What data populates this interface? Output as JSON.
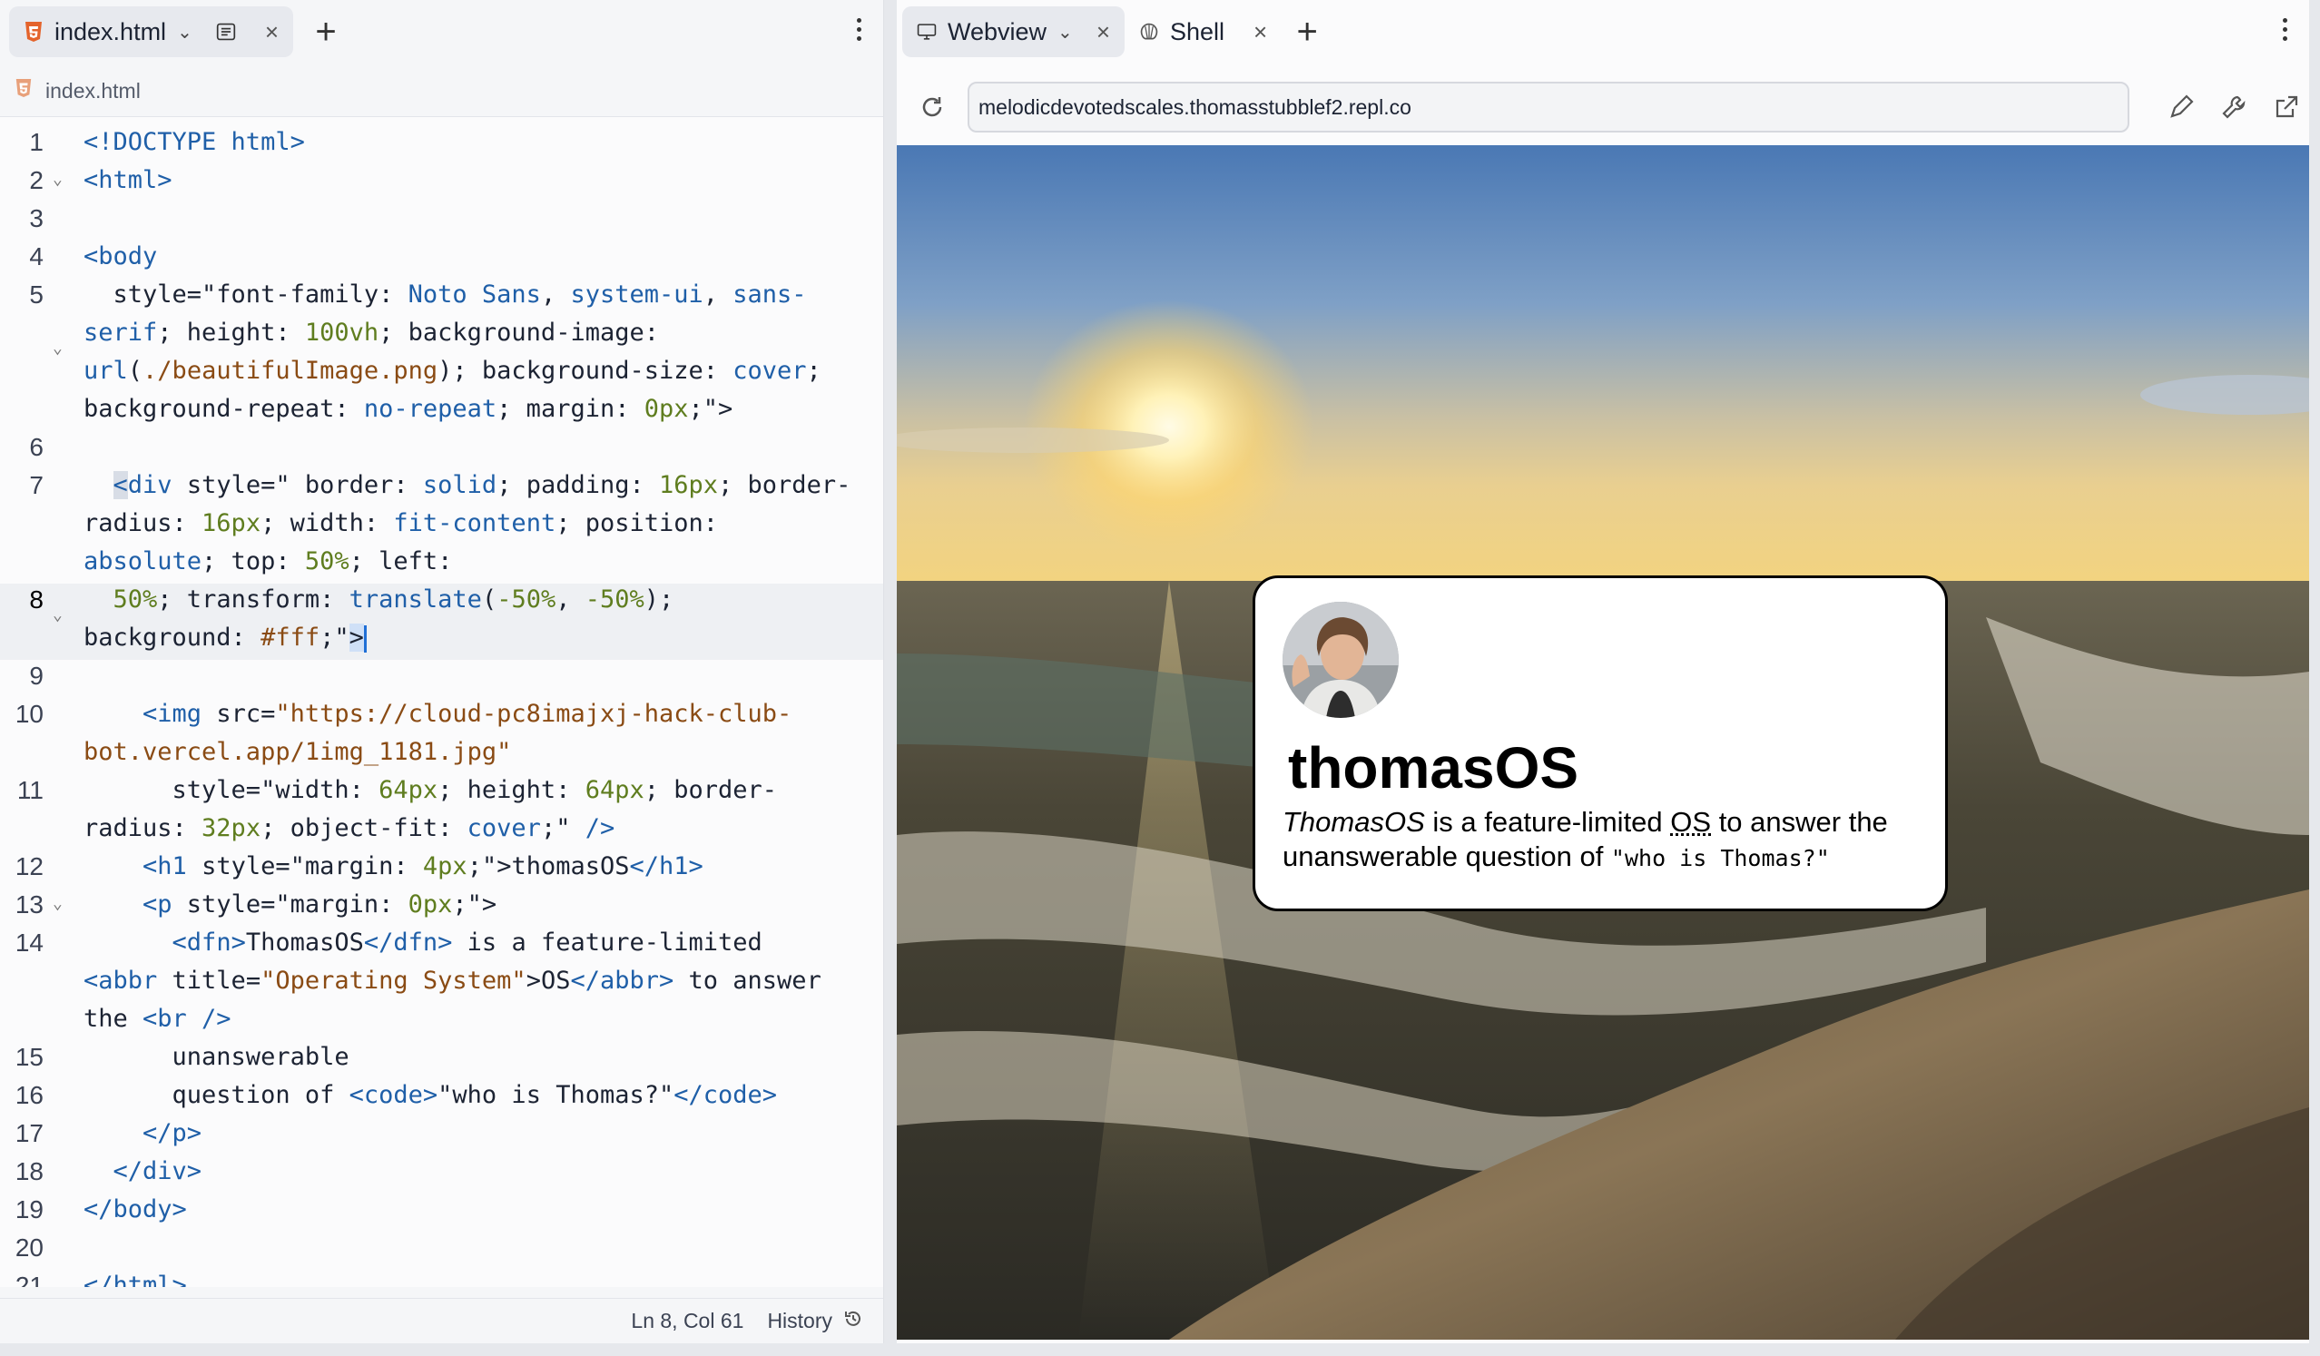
{
  "left_tabs": {
    "file_tab": "index.html",
    "breadcrumb": "index.html"
  },
  "right_tabs": {
    "webview_tab": "Webview",
    "shell_tab": "Shell"
  },
  "code_lines": [
    {
      "n": "1"
    },
    {
      "n": "2"
    },
    {
      "n": "3"
    },
    {
      "n": "4"
    },
    {
      "n": "5"
    },
    {
      "n": "6"
    },
    {
      "n": "7"
    },
    {
      "n": "8"
    },
    {
      "n": "9"
    },
    {
      "n": "10"
    },
    {
      "n": "11"
    },
    {
      "n": "12"
    },
    {
      "n": "13"
    },
    {
      "n": "14"
    },
    {
      "n": "15"
    },
    {
      "n": "16"
    },
    {
      "n": "17"
    },
    {
      "n": "18"
    },
    {
      "n": "19"
    },
    {
      "n": "20"
    },
    {
      "n": "21"
    }
  ],
  "status": {
    "position": "Ln 8, Col 61",
    "history": "History"
  },
  "webview": {
    "url": "melodicdevotedscales.thomasstubblef2.repl.co"
  },
  "card": {
    "title": "thomasOS",
    "dfn": "ThomasOS",
    "text_a": " is a feature-limited ",
    "abbr": "OS",
    "text_b": " to answer the",
    "text_c": "unanswerable question of ",
    "code": "\"who is Thomas?\""
  },
  "colors": {
    "accent": "#1f6fd6",
    "html_icon": "#e4632b"
  }
}
